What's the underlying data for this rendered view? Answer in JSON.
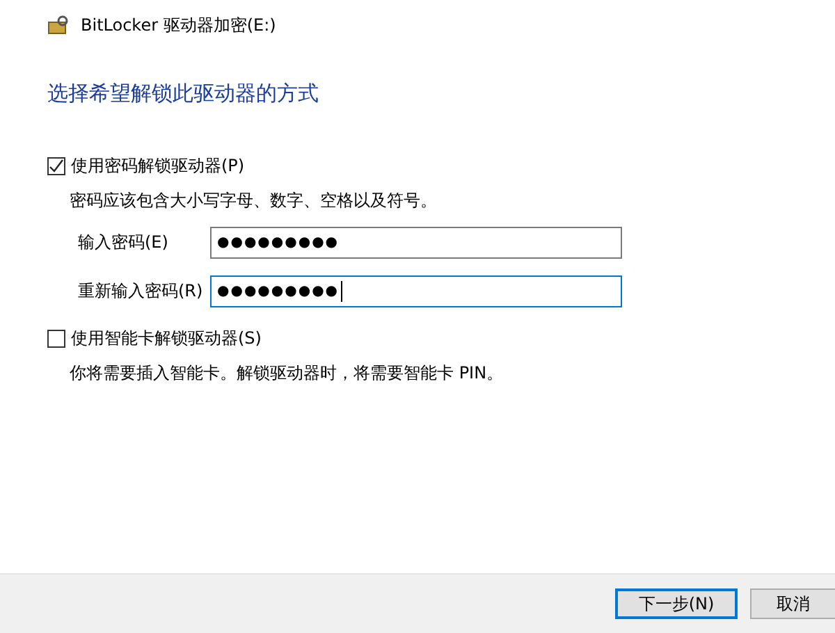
{
  "window": {
    "title": "BitLocker 驱动器加密(E:)"
  },
  "heading": "选择希望解锁此驱动器的方式",
  "options": [
    {
      "label": "使用密码解锁驱动器(P)",
      "checked": true,
      "note": "密码应该包含大小写字母、数字、空格以及符号。",
      "fields": [
        {
          "label": "输入密码(E)",
          "value": "●●●●●●●●●",
          "focused": false
        },
        {
          "label": "重新输入密码(R)",
          "value": "●●●●●●●●●",
          "focused": true
        }
      ]
    },
    {
      "label": "使用智能卡解锁驱动器(S)",
      "checked": false,
      "note": "你将需要插入智能卡。解锁驱动器时，将需要智能卡 PIN。"
    }
  ],
  "buttons": [
    {
      "label": "下一步(N)",
      "default": true
    },
    {
      "label": "取消",
      "default": false
    }
  ]
}
